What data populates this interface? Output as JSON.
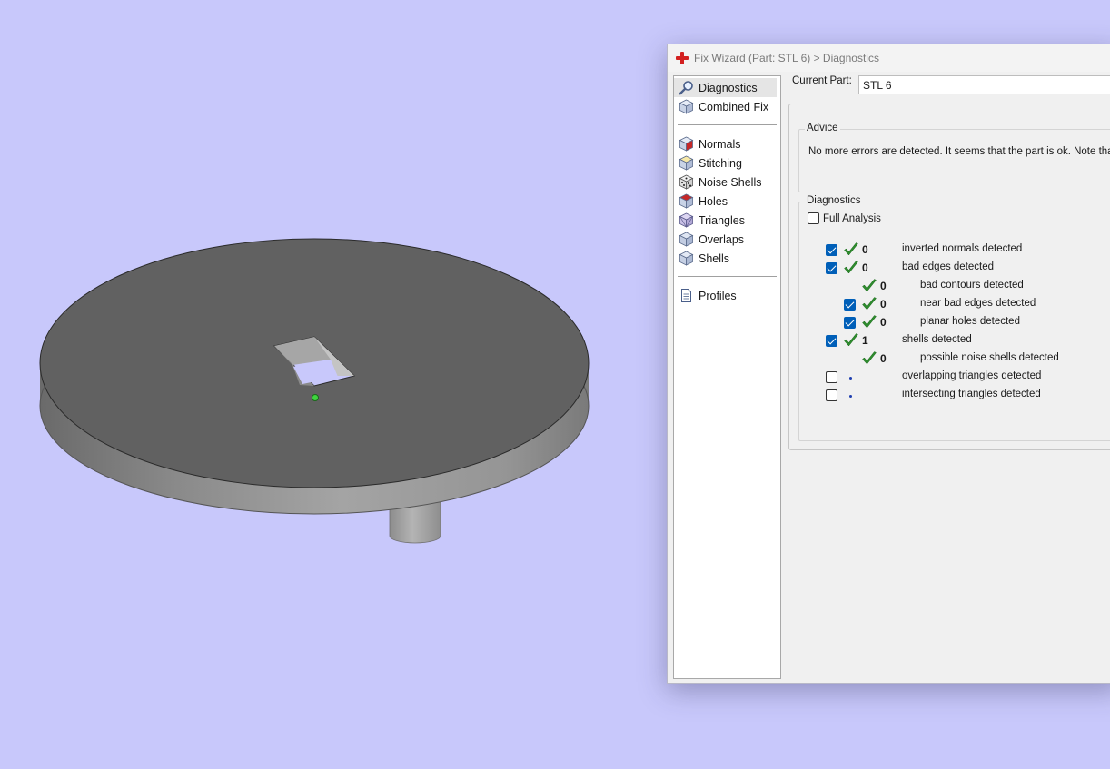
{
  "window": {
    "title": "Fix Wizard (Part: STL 6) > Diagnostics",
    "current_part_label": "Current Part:",
    "current_part_value": "STL 6"
  },
  "nav": {
    "group1": [
      {
        "label": "Diagnostics",
        "icon": "magnifier-icon",
        "active": true
      },
      {
        "label": "Combined Fix",
        "icon": "cube-icon"
      }
    ],
    "group2": [
      {
        "label": "Normals",
        "icon": "normals-cube-icon"
      },
      {
        "label": "Stitching",
        "icon": "stitching-cube-icon"
      },
      {
        "label": "Noise Shells",
        "icon": "dice-icon"
      },
      {
        "label": "Holes",
        "icon": "holes-cube-icon"
      },
      {
        "label": "Triangles",
        "icon": "triangles-cube-icon"
      },
      {
        "label": "Overlaps",
        "icon": "overlaps-cube-icon"
      },
      {
        "label": "Shells",
        "icon": "shells-cube-icon"
      }
    ],
    "group3": [
      {
        "label": "Profiles",
        "icon": "document-icon"
      }
    ]
  },
  "advice": {
    "title": "Advice",
    "text": "No more errors are detected. It seems that the part is ok. Note that m"
  },
  "diagnostics": {
    "title": "Diagnostics",
    "full_analysis_label": "Full Analysis",
    "full_analysis_checked": false,
    "rows": [
      {
        "level": 0,
        "checkbox": true,
        "checked": true,
        "status": "ok",
        "count": "0",
        "label": "inverted normals detected"
      },
      {
        "level": 0,
        "checkbox": true,
        "checked": true,
        "status": "ok",
        "count": "0",
        "label": "bad edges detected"
      },
      {
        "level": 1,
        "checkbox": false,
        "checked": false,
        "status": "ok",
        "count": "0",
        "label": "bad contours detected"
      },
      {
        "level": 1,
        "checkbox": true,
        "checked": true,
        "status": "ok",
        "count": "0",
        "label": "near bad edges detected"
      },
      {
        "level": 1,
        "checkbox": true,
        "checked": true,
        "status": "ok",
        "count": "0",
        "label": "planar holes detected"
      },
      {
        "level": 0,
        "checkbox": true,
        "checked": true,
        "status": "ok",
        "count": "1",
        "label": "shells detected"
      },
      {
        "level": 1,
        "checkbox": false,
        "checked": false,
        "status": "ok",
        "count": "0",
        "label": "possible noise shells detected"
      },
      {
        "level": 0,
        "checkbox": true,
        "checked": false,
        "status": "pending",
        "count": "",
        "label": "overlapping triangles detected"
      },
      {
        "level": 0,
        "checkbox": true,
        "checked": false,
        "status": "pending",
        "count": "",
        "label": "intersecting triangles detected"
      }
    ]
  },
  "colors": {
    "viewport_bg": "#c8c8fb",
    "check_green": "#2e8b2e",
    "checkbox_blue": "#005fb8",
    "app_red": "#d32020"
  }
}
